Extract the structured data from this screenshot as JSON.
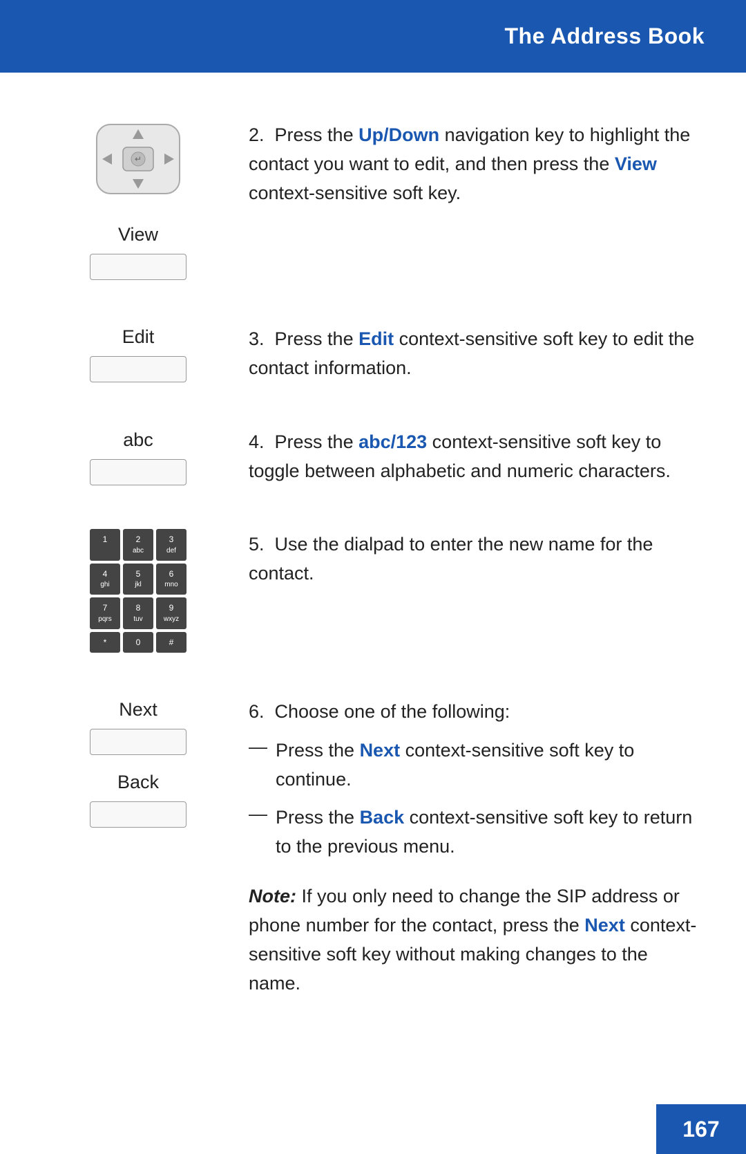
{
  "header": {
    "title": "The Address Book",
    "background": "#1a57b0"
  },
  "page_number": "167",
  "steps": [
    {
      "number": "2.",
      "text_parts": [
        {
          "text": "Press the ",
          "style": "normal"
        },
        {
          "text": "Up/Down",
          "style": "blue"
        },
        {
          "text": " navigation key to highlight the contact you want to edit, and then press the ",
          "style": "normal"
        },
        {
          "text": "View",
          "style": "blue"
        },
        {
          "text": " context-sensitive soft key.",
          "style": "normal"
        }
      ],
      "left_type": "nav_with_softkey",
      "softkey_label": "View"
    },
    {
      "number": "3.",
      "text_parts": [
        {
          "text": "Press the ",
          "style": "normal"
        },
        {
          "text": "Edit",
          "style": "blue"
        },
        {
          "text": " context-sensitive soft key to edit the contact information.",
          "style": "normal"
        }
      ],
      "left_type": "softkey_only",
      "softkey_label": "Edit"
    },
    {
      "number": "4.",
      "text_parts": [
        {
          "text": "Press the ",
          "style": "normal"
        },
        {
          "text": "abc/123",
          "style": "blue"
        },
        {
          "text": " context-sensitive soft key to toggle between alphabetic and numeric characters.",
          "style": "normal"
        }
      ],
      "left_type": "softkey_only",
      "softkey_label": "abc"
    },
    {
      "number": "5.",
      "text_parts": [
        {
          "text": "Use the dialpad to enter the new name for the contact.",
          "style": "normal"
        }
      ],
      "left_type": "dialpad"
    },
    {
      "number": "6.",
      "text_parts": [
        {
          "text": "Choose one of the following:",
          "style": "normal"
        }
      ],
      "bullets": [
        {
          "text_parts": [
            {
              "text": "Press the ",
              "style": "normal"
            },
            {
              "text": "Next",
              "style": "blue"
            },
            {
              "text": " context-sensitive soft key to continue.",
              "style": "normal"
            }
          ]
        },
        {
          "text_parts": [
            {
              "text": "Press the ",
              "style": "normal"
            },
            {
              "text": "Back",
              "style": "blue"
            },
            {
              "text": " context-sensitive soft key to return to the previous menu.",
              "style": "normal"
            }
          ]
        }
      ],
      "note": {
        "text_parts": [
          {
            "text": "Note:",
            "style": "bold-italic"
          },
          {
            "text": " If you only need to change the SIP address or phone number for the contact, press the ",
            "style": "normal"
          },
          {
            "text": "Next",
            "style": "blue"
          },
          {
            "text": " context-sensitive soft key without making changes to the name.",
            "style": "normal"
          }
        ]
      },
      "left_type": "next_back",
      "next_label": "Next",
      "back_label": "Back"
    }
  ],
  "dialpad_keys": [
    {
      "top": "1",
      "sub": ""
    },
    {
      "top": "2",
      "sub": "abc"
    },
    {
      "top": "3",
      "sub": "def"
    },
    {
      "top": "4",
      "sub": "ghi"
    },
    {
      "top": "5",
      "sub": "jkl"
    },
    {
      "top": "6",
      "sub": "mno"
    },
    {
      "top": "7",
      "sub": "pqrs"
    },
    {
      "top": "8",
      "sub": "tuv"
    },
    {
      "top": "9",
      "sub": "wxyz"
    },
    {
      "top": "*",
      "sub": ""
    },
    {
      "top": "0",
      "sub": "+"
    },
    {
      "top": "#",
      "sub": ""
    }
  ]
}
